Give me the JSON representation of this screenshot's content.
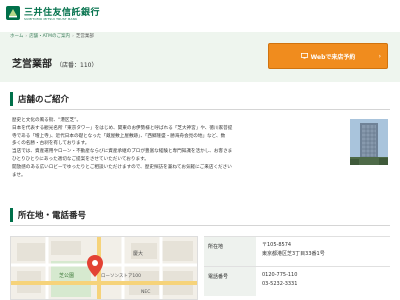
{
  "header": {
    "bank_name": "三井住友信託銀行",
    "bank_name_en": "SUMITOMO MITSUI TRUST BANK"
  },
  "breadcrumb": {
    "items": [
      "ホーム",
      "店舗・ATMのご案内"
    ],
    "current": "芝営業部"
  },
  "branch": {
    "name": "芝営業部",
    "number": "（店番：110）"
  },
  "web_reservation_button": {
    "label": "Webで来店予約"
  },
  "intro_section": {
    "heading": "店舗のご紹介",
    "lines": [
      "歴史と文化の風る街、“港区芝”。",
      "日本を代表する観光名所「東京タワー」をはじめ、関東のお伊勢様と呼ばれる「芝大神宮」や、徳川家菩提",
      "寺である「増上寺」、近代日本の礎となった「蔵屋敷上屋敷跡」、「西郷隆盛・勝海舟会見の地」など、数",
      "多くの名勝・古刹を有しております。",
      "当店では、資産運用やローン・不動産ならびに資産承継のプロが豊富な経験と専門知識を活かし、お客さま",
      "ひとりひとりにあった適切なご提案をさせていただいております。",
      "開放感のある広いロビーでゆったりとご相談いただけますので、歴史探訪を兼ねてお気軽にご来店ください",
      "ませ。"
    ]
  },
  "location_section": {
    "heading": "所在地・電話番号",
    "address_label": "所在地",
    "postal_code": "〒105-8574",
    "address": "東京都港区芝3丁目33番1号",
    "phone_label": "電話番号",
    "phone_1": "0120-775-110",
    "phone_2": "03-5232-3331"
  },
  "map": {
    "labels": [
      "ローソンストア100",
      "芝公園",
      "慶大",
      "NEC"
    ]
  },
  "colors": {
    "brand_green": "#00704a",
    "accent_orange": "#f08c1e",
    "light_green_bg": "#eef5ee"
  }
}
